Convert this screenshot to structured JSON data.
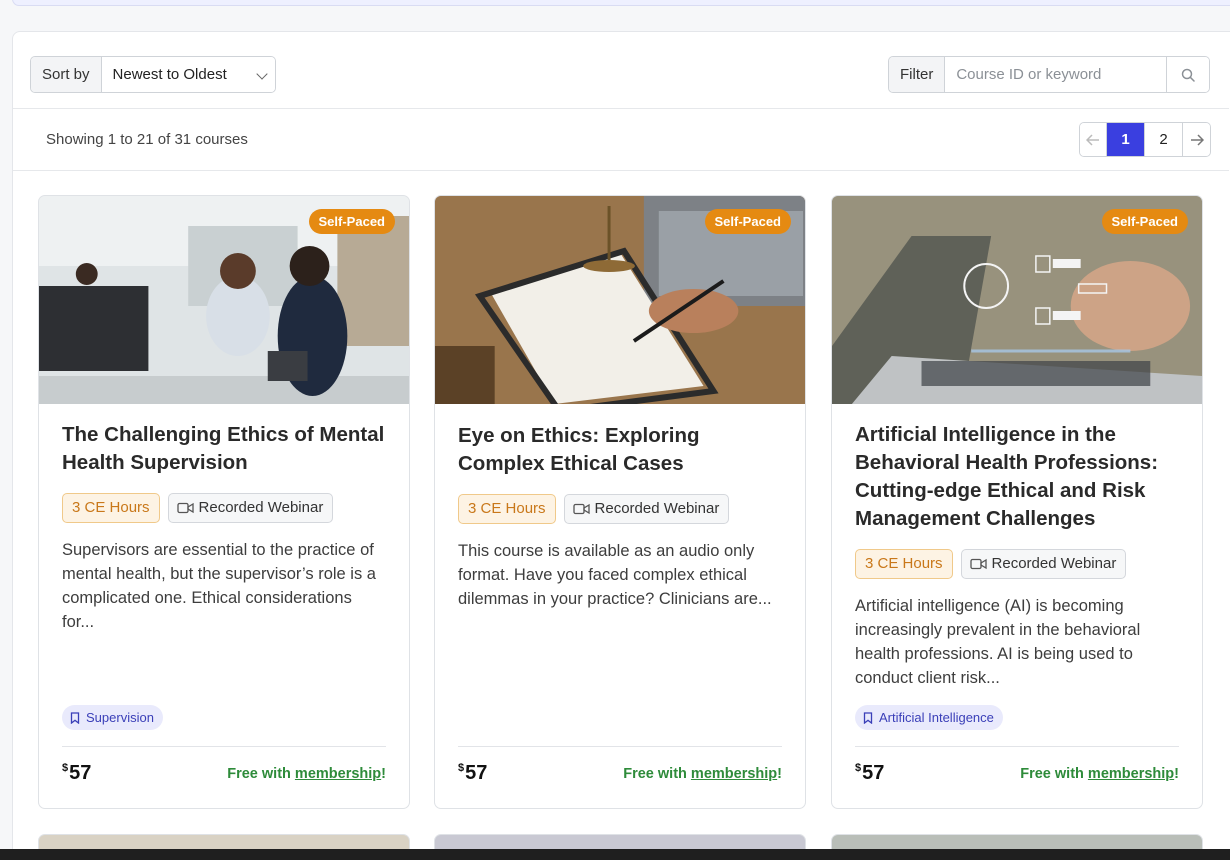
{
  "toolbar": {
    "sort_label": "Sort by",
    "sort_value": "Newest to Oldest",
    "filter_label": "Filter",
    "filter_placeholder": "Course ID or keyword",
    "search_icon": "search-icon"
  },
  "status": {
    "prefix": "Showing ",
    "from": "1",
    "to_word": " to ",
    "to": "21",
    "of_word": " of ",
    "total": "31",
    "suffix": " courses"
  },
  "pagination": {
    "prev_icon": "arrow-left-icon",
    "pages": [
      "1",
      "2"
    ],
    "active_page": "1",
    "next_icon": "arrow-right-icon"
  },
  "courses": [
    {
      "badge": "Self-Paced",
      "title": "The Challenging Ethics of Mental Health Supervision",
      "ce_hours": "3 CE Hours",
      "format": "Recorded Webinar",
      "description": "Supervisors are essential to the practice of mental health, but the supervisor’s role is a complicated one. Ethical considerations for...",
      "tag": "Supervision",
      "price_symbol": "$",
      "price": "57",
      "free_prefix": "Free with ",
      "free_link": "membership",
      "free_suffix": "!"
    },
    {
      "badge": "Self-Paced",
      "title": "Eye on Ethics: Exploring Complex Ethical Cases",
      "ce_hours": "3 CE Hours",
      "format": "Recorded Webinar",
      "description": "This course is available as an audio only format. Have you faced complex ethical dilemmas in your practice? Clinicians are...",
      "tag": "",
      "price_symbol": "$",
      "price": "57",
      "free_prefix": "Free with ",
      "free_link": "membership",
      "free_suffix": "!"
    },
    {
      "badge": "Self-Paced",
      "title": "Artificial Intelligence in the Behavioral Health Professions: Cutting-edge Ethical and Risk Management Challenges",
      "ce_hours": "3 CE Hours",
      "format": "Recorded Webinar",
      "description": "Artificial intelligence (AI) is becoming increasingly prevalent in the behavioral health professions. AI is being used to conduct client risk...",
      "tag": "Artificial Intelligence",
      "price_symbol": "$",
      "price": "57",
      "free_prefix": "Free with ",
      "free_link": "membership",
      "free_suffix": "!"
    }
  ],
  "colors": {
    "accent": "#3a3fe0",
    "badge": "#e58a12",
    "ce_chip": "#c9781a",
    "free_text": "#2e8b3a",
    "tag_text": "#3a3fb8"
  }
}
